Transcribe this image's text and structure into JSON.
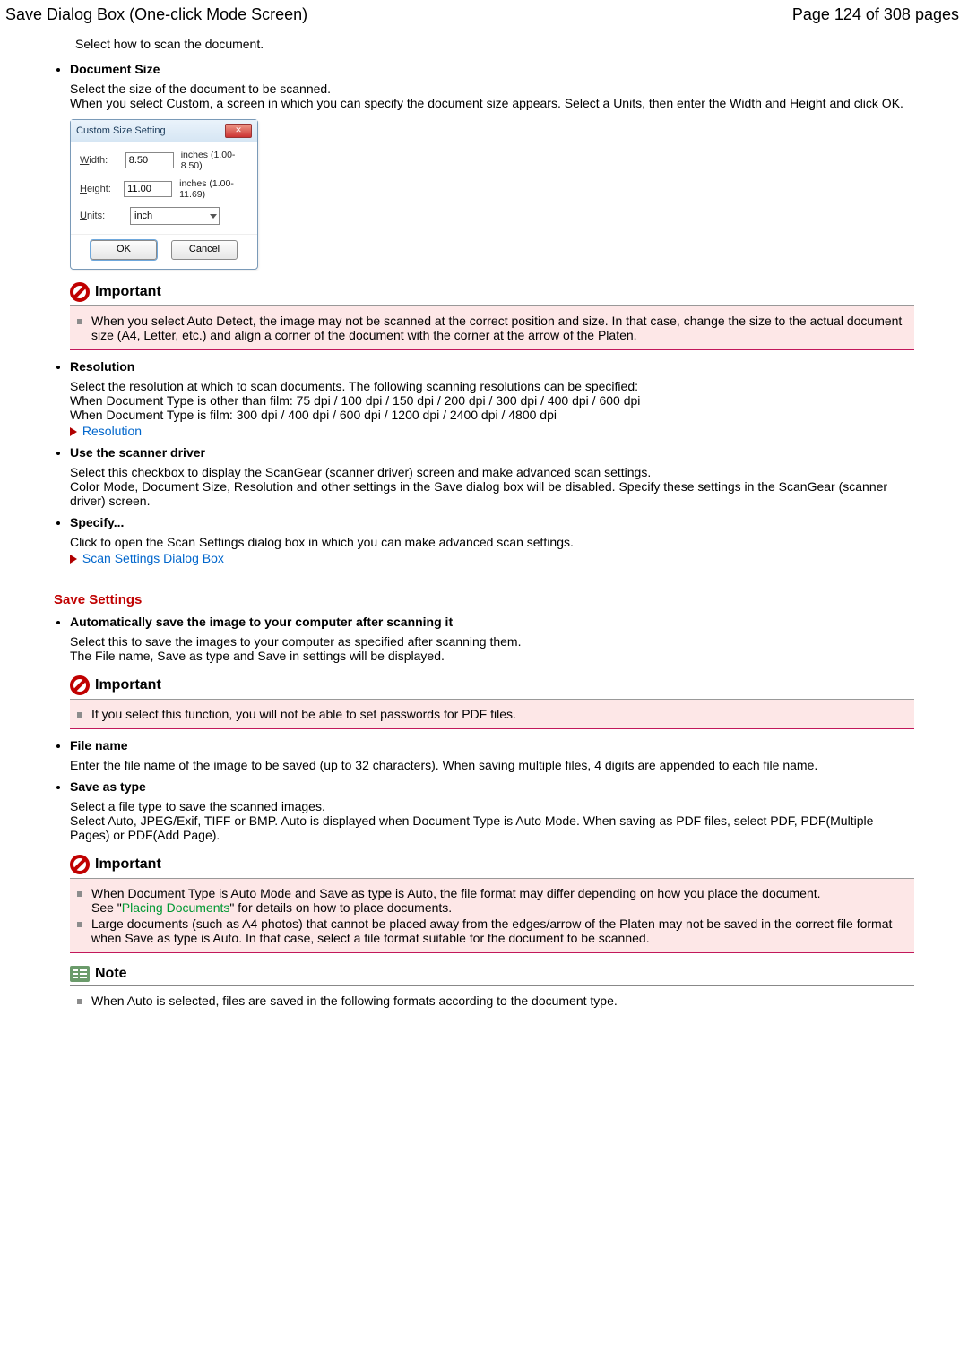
{
  "header": {
    "title": "Save Dialog Box (One-click Mode Screen)",
    "page_info": "Page 124 of 308 pages"
  },
  "intro": "Select how to scan the document.",
  "doc_size": {
    "title": "Document Size",
    "body_1": "Select the size of the document to be scanned.",
    "body_2": "When you select Custom, a screen in which you can specify the document size appears. Select a Units, then enter the Width and Height and click OK."
  },
  "dialog": {
    "title": "Custom Size Setting",
    "width_label_pre": "W",
    "width_label_rest": "idth:",
    "width_value": "8.50",
    "width_range": "inches (1.00-8.50)",
    "height_label_pre": "H",
    "height_label_rest": "eight:",
    "height_value": "11.00",
    "height_range": "inches (1.00-11.69)",
    "units_label_pre": "U",
    "units_label_rest": "nits:",
    "units_value": "inch",
    "ok": "OK",
    "cancel_pre": "C",
    "cancel_rest": "ancel"
  },
  "important1": {
    "title": "Important",
    "text": "When you select Auto Detect, the image may not be scanned at the correct position and size. In that case, change the size to the actual document size (A4, Letter, etc.) and align a corner of the document with the corner at the arrow of the Platen."
  },
  "resolution": {
    "title": "Resolution",
    "body_1": "Select the resolution at which to scan documents. The following scanning resolutions can be specified:",
    "body_2": "When Document Type is other than film: 75 dpi / 100 dpi / 150 dpi / 200 dpi / 300 dpi / 400 dpi / 600 dpi",
    "body_3": "When Document Type is film: 300 dpi / 400 dpi / 600 dpi / 1200 dpi / 2400 dpi / 4800 dpi",
    "link": "Resolution"
  },
  "scanner_driver": {
    "title": "Use the scanner driver",
    "body_1": "Select this checkbox to display the ScanGear (scanner driver) screen and make advanced scan settings.",
    "body_2": "Color Mode, Document Size, Resolution and other settings in the Save dialog box will be disabled. Specify these settings in the ScanGear (scanner driver) screen."
  },
  "specify": {
    "title": "Specify...",
    "body": "Click to open the Scan Settings dialog box in which you can make advanced scan settings.",
    "link": "Scan Settings Dialog Box"
  },
  "save_settings_heading": "Save Settings",
  "auto_save": {
    "title": "Automatically save the image to your computer after scanning it",
    "body_1": "Select this to save the images to your computer as specified after scanning them.",
    "body_2": "The File name, Save as type and Save in settings will be displayed."
  },
  "important2": {
    "title": "Important",
    "text": "If you select this function, you will not be able to set passwords for PDF files."
  },
  "file_name": {
    "title": "File name",
    "body": "Enter the file name of the image to be saved (up to 32 characters). When saving multiple files, 4 digits are appended to each file name."
  },
  "save_as_type": {
    "title": "Save as type",
    "body_1": "Select a file type to save the scanned images.",
    "body_2": "Select Auto, JPEG/Exif, TIFF or BMP. Auto is displayed when Document Type is Auto Mode. When saving as PDF files, select PDF, PDF(Multiple Pages) or PDF(Add Page)."
  },
  "important3": {
    "title": "Important",
    "item1_a": "When Document Type is Auto Mode and Save as type is Auto, the file format may differ depending on how you place the document.",
    "item1_b_pre": "See \"",
    "item1_b_link": "Placing Documents",
    "item1_b_post": "\" for details on how to place documents.",
    "item2": "Large documents (such as A4 photos) that cannot be placed away from the edges/arrow of the Platen may not be saved in the correct file format when Save as type is Auto. In that case, select a file format suitable for the document to be scanned."
  },
  "note": {
    "title": "Note",
    "text": "When Auto is selected, files are saved in the following formats according to the document type."
  }
}
